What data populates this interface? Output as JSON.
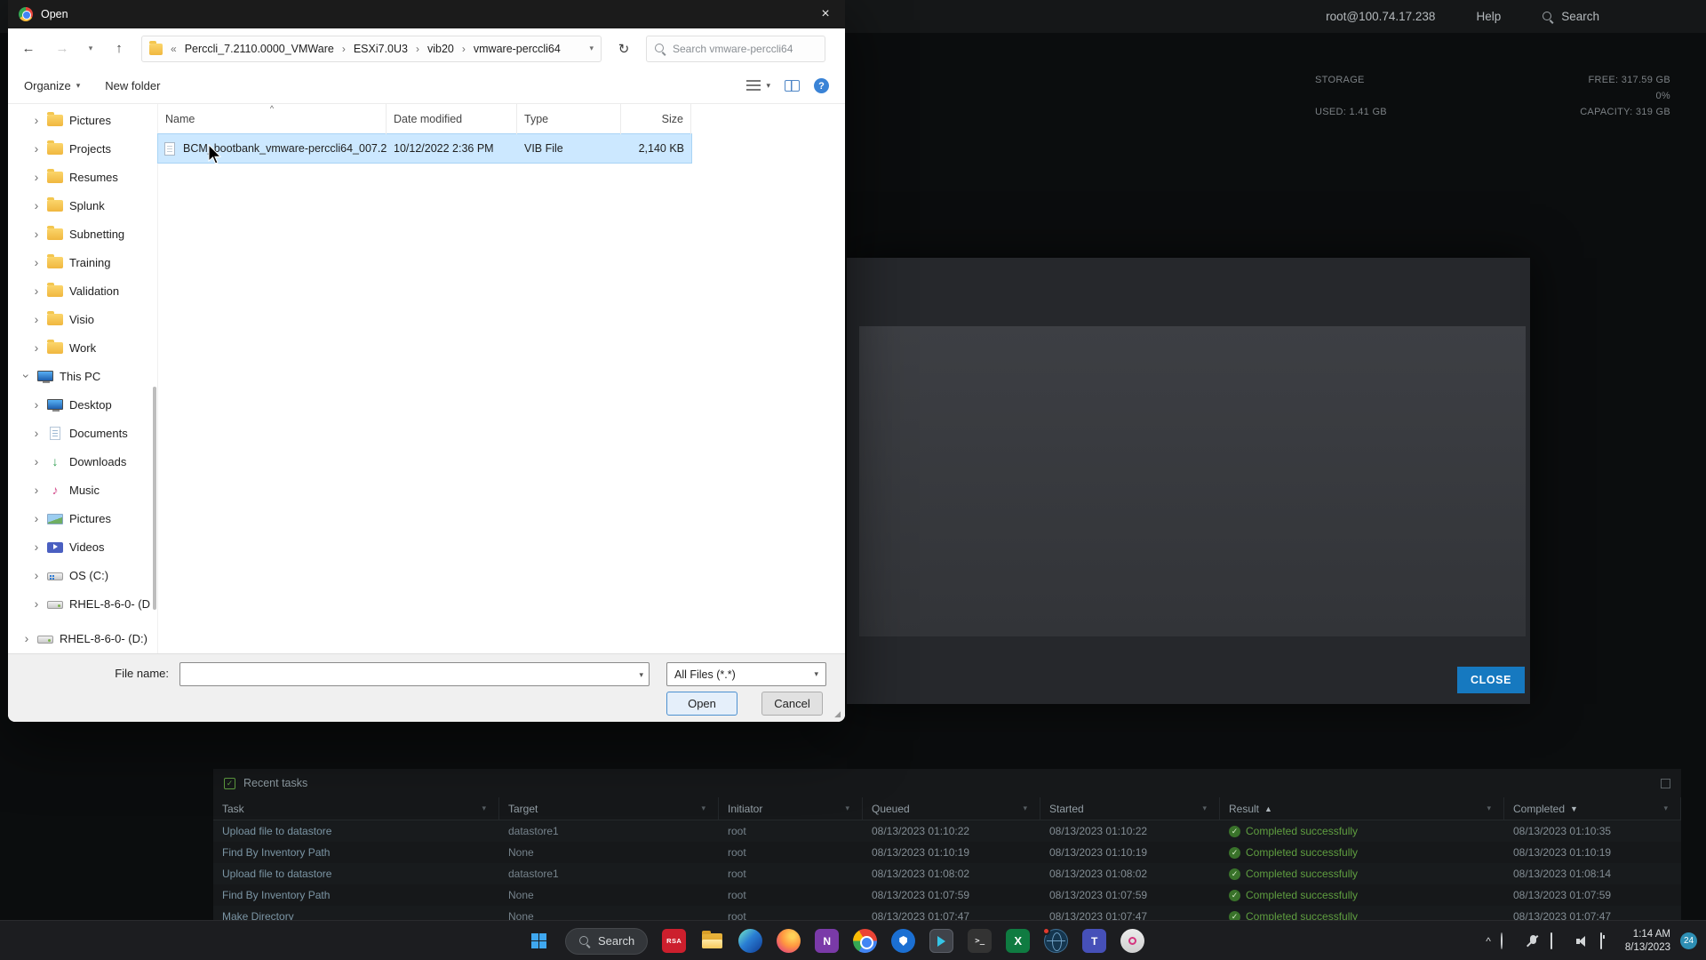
{
  "colors": {
    "accent_blue": "#1679c0",
    "success_green": "#5f9e40",
    "selection_blue": "#cce8ff"
  },
  "icons": {
    "back": "←",
    "forward": "→",
    "up": "↑",
    "refresh": "↻",
    "history": "▾",
    "dropdown": "▾",
    "chevron": "›",
    "ellipsis": "«",
    "sort_name": "^",
    "sort_asc": "▲",
    "sort_desc": "▼",
    "filter": "▾",
    "check": "✓",
    "close": "×",
    "help": "?",
    "tray_chevron": "^",
    "down_arrow": "↓",
    "music_note": "♪",
    "terminal_glyph": ">_",
    "excel": "X",
    "onenote": "N",
    "teams": "T",
    "resize_grip": "◢"
  },
  "dialog": {
    "title": "Open",
    "nav": {
      "segments": [
        "Perccli_7.2110.0000_VMWare",
        "ESXi7.0U3",
        "vib20",
        "vmware-perccli64"
      ],
      "search_placeholder": "Search vmware-perccli64"
    },
    "toolbar": {
      "organize": "Organize",
      "new_folder": "New folder"
    },
    "columns": [
      "Name",
      "Date modified",
      "Type",
      "Size"
    ],
    "file": {
      "name": "BCM_bootbank_vmware-perccli64_007.2...",
      "date": "10/12/2022 2:36 PM",
      "type": "VIB File",
      "size": "2,140 KB"
    },
    "sidebar": {
      "items": [
        {
          "label": "Pictures"
        },
        {
          "label": "Projects"
        },
        {
          "label": "Resumes"
        },
        {
          "label": "Splunk"
        },
        {
          "label": "Subnetting"
        },
        {
          "label": "Training"
        },
        {
          "label": "Validation"
        },
        {
          "label": "Visio"
        },
        {
          "label": "Work"
        },
        {
          "label": "This PC"
        },
        {
          "label": "Desktop"
        },
        {
          "label": "Documents"
        },
        {
          "label": "Downloads"
        },
        {
          "label": "Music"
        },
        {
          "label": "Pictures"
        },
        {
          "label": "Videos"
        },
        {
          "label": "OS (C:)"
        },
        {
          "label": "RHEL-8-6-0- (D"
        },
        {
          "label": "RHEL-8-6-0- (D:)"
        }
      ]
    },
    "footer": {
      "file_name_label": "File name:",
      "file_name_value": "",
      "file_type": "All Files (*.*)",
      "open": "Open",
      "cancel": "Cancel"
    }
  },
  "esxi": {
    "header": {
      "user": "root@100.74.17.238",
      "help": "Help",
      "search": "Search"
    },
    "storage": {
      "title": "STORAGE",
      "free": "FREE: 317.59 GB",
      "percent": "0%",
      "used": "USED: 1.41 GB",
      "capacity": "CAPACITY: 319 GB"
    },
    "modal": {
      "close": "CLOSE"
    },
    "tasks": {
      "title": "Recent tasks",
      "columns": [
        "Task",
        "Target",
        "Initiator",
        "Queued",
        "Started",
        "Result",
        "Completed"
      ],
      "rows": [
        {
          "task": "Upload file to datastore",
          "target": "datastore1",
          "initiator": "root",
          "queued": "08/13/2023 01:10:22",
          "started": "08/13/2023 01:10:22",
          "result": "Completed successfully",
          "completed": "08/13/2023 01:10:35"
        },
        {
          "task": "Find By Inventory Path",
          "target": "None",
          "initiator": "root",
          "queued": "08/13/2023 01:10:19",
          "started": "08/13/2023 01:10:19",
          "result": "Completed successfully",
          "completed": "08/13/2023 01:10:19"
        },
        {
          "task": "Upload file to datastore",
          "target": "datastore1",
          "initiator": "root",
          "queued": "08/13/2023 01:08:02",
          "started": "08/13/2023 01:08:02",
          "result": "Completed successfully",
          "completed": "08/13/2023 01:08:14"
        },
        {
          "task": "Find By Inventory Path",
          "target": "None",
          "initiator": "root",
          "queued": "08/13/2023 01:07:59",
          "started": "08/13/2023 01:07:59",
          "result": "Completed successfully",
          "completed": "08/13/2023 01:07:59"
        },
        {
          "task": "Make Directory",
          "target": "None",
          "initiator": "root",
          "queued": "08/13/2023 01:07:47",
          "started": "08/13/2023 01:07:47",
          "result": "Completed successfully",
          "completed": "08/13/2023 01:07:47"
        }
      ]
    }
  },
  "taskbar": {
    "search": "Search",
    "rsa": "RSA",
    "time": "1:14 AM",
    "date": "8/13/2023",
    "badge": "24"
  }
}
